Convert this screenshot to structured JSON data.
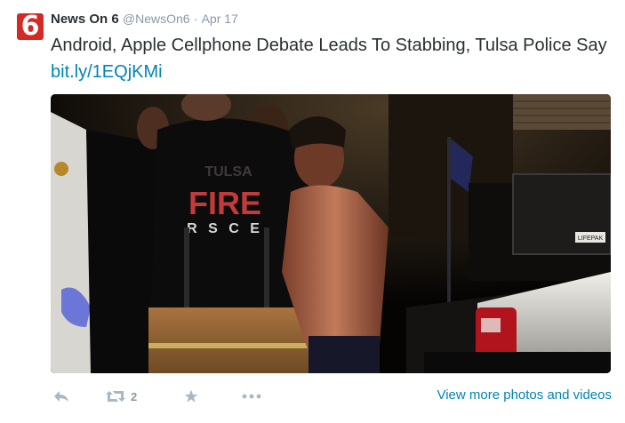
{
  "tweet": {
    "avatar_text": "6",
    "display_name": "News On 6",
    "handle": "@NewsOn6",
    "separator": "·",
    "date": "Apr 17",
    "text": "Android, Apple Cellphone Debate Leads To Stabbing, Tulsa Police Say",
    "link": "bit.ly/1EQjKMi",
    "retweet_count": "2",
    "view_more": "View more photos and videos"
  },
  "photo_text": {
    "jacket_line1": "TULSA",
    "jacket_line2": "FIRE",
    "jacket_line3": "R S C E",
    "equipment_label": "LIFEPAK"
  },
  "colors": {
    "brand_red": "#d42a25",
    "link_blue": "#0084b4",
    "meta_gray": "#8899a6",
    "icon_gray": "#aab8c2"
  },
  "icons": [
    "reply-icon",
    "retweet-icon",
    "favorite-icon",
    "more-icon"
  ]
}
